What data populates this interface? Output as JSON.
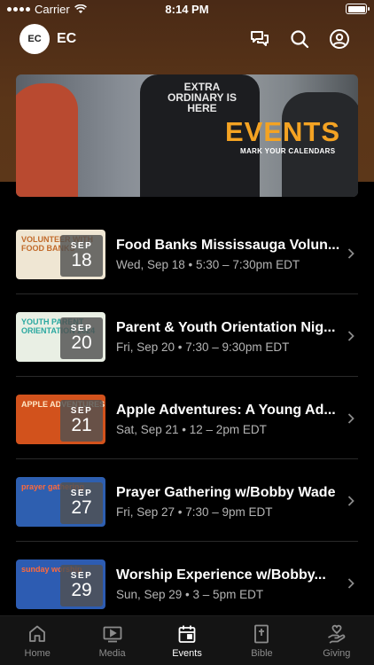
{
  "status_bar": {
    "carrier": "Carrier",
    "time": "8:14 PM"
  },
  "header": {
    "avatar_initials": "EC",
    "app_name": "EC"
  },
  "banner": {
    "title": "EVENTS",
    "subtitle": "MARK YOUR CALENDARS",
    "shirt_text": "EXTRA ORDINARY IS HERE"
  },
  "events": [
    {
      "month": "SEP",
      "day": "18",
      "title": "Food Banks Mississauga Volun...",
      "meta": "Wed, Sep 18 • 5:30 – 7:30pm EDT",
      "thumb_text": "VOLUNTEER WITH FOOD BANKS",
      "thumb_bg": "#efe6d3",
      "thumb_fg": "#c26a2a"
    },
    {
      "month": "SEP",
      "day": "20",
      "title": "Parent & Youth Orientation Nig...",
      "meta": "Fri, Sep 20 • 7:30 – 9:30pm EDT",
      "thumb_text": "YOUTH PARENT ORIENTATION 2024",
      "thumb_bg": "#e9efe4",
      "thumb_fg": "#2aa8a0"
    },
    {
      "month": "SEP",
      "day": "21",
      "title": "Apple Adventures: A Young Ad...",
      "meta": "Sat, Sep 21 • 12 – 2pm EDT",
      "thumb_text": "APPLE ADVENTURES",
      "thumb_bg": "#d2521c",
      "thumb_fg": "#ffe8c8"
    },
    {
      "month": "SEP",
      "day": "27",
      "title": "Prayer Gathering w/Bobby Wade",
      "meta": "Fri, Sep 27 • 7:30 – 9pm EDT",
      "thumb_text": "prayer gathering",
      "thumb_bg": "#2e5fb0",
      "thumb_fg": "#ff6a3a"
    },
    {
      "month": "SEP",
      "day": "29",
      "title": "Worship Experience w/Bobby...",
      "meta": "Sun, Sep 29 • 3 – 5pm EDT",
      "thumb_text": "sunday worship",
      "thumb_bg": "#2d5cb2",
      "thumb_fg": "#ff6a3a"
    }
  ],
  "tabs": [
    {
      "label": "Home",
      "icon": "home-icon",
      "active": false
    },
    {
      "label": "Media",
      "icon": "media-play-icon",
      "active": false
    },
    {
      "label": "Events",
      "icon": "calendar-icon",
      "active": true
    },
    {
      "label": "Bible",
      "icon": "bible-icon",
      "active": false
    },
    {
      "label": "Giving",
      "icon": "giving-heart-hand-icon",
      "active": false
    }
  ]
}
